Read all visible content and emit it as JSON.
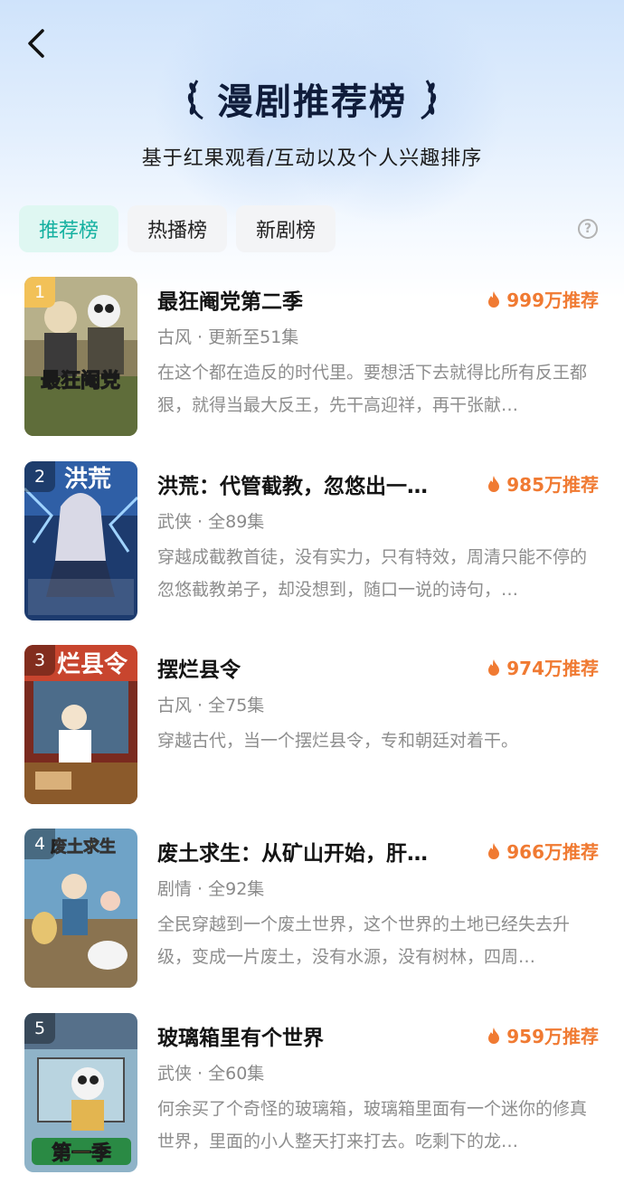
{
  "page": {
    "title": "漫剧推荐榜",
    "subtitle": "基于红果观看/互动以及个人兴趣排序"
  },
  "tabs": [
    {
      "label": "推荐榜",
      "active": true
    },
    {
      "label": "热播榜",
      "active": false
    },
    {
      "label": "新剧榜",
      "active": false
    }
  ],
  "colors": {
    "accent": "#14b0a0",
    "recommend": "#f07a32",
    "gold_rank": "#f2c158"
  },
  "items": [
    {
      "rank": "1",
      "title": "最狂阉党第二季",
      "meta": "古风 · 更新至51集",
      "recommend": "999万推荐",
      "desc": "在这个都在造反的时代里。要想活下去就得比所有反王都狠，就得当最大反王，先干高迎祥，再干张献…",
      "cover_text": "最狂阉党"
    },
    {
      "rank": "2",
      "title": "洪荒：代管截教，忽悠出一…",
      "meta": "武侠 · 全89集",
      "recommend": "985万推荐",
      "desc": "穿越成截教首徒，没有实力，只有特效，周清只能不停的忽悠截教弟子，却没想到，随口一说的诗句，…",
      "cover_text": "洪荒"
    },
    {
      "rank": "3",
      "title": "摆烂县令",
      "meta": "古风 · 全75集",
      "recommend": "974万推荐",
      "desc": "穿越古代，当一个摆烂县令，专和朝廷对着干。",
      "cover_text": "烂县令"
    },
    {
      "rank": "4",
      "title": "废土求生：从矿山开始，肝…",
      "meta": "剧情 · 全92集",
      "recommend": "966万推荐",
      "desc": "全民穿越到一个废土世界，这个世界的土地已经失去升级，变成一片废土，没有水源，没有树林，四周…",
      "cover_text": "废土求生"
    },
    {
      "rank": "5",
      "title": "玻璃箱里有个世界",
      "meta": "武侠 · 全60集",
      "recommend": "959万推荐",
      "desc": "何余买了个奇怪的玻璃箱，玻璃箱里面有一个迷你的修真世界，里面的小人整天打来打去。吃剩下的龙…",
      "cover_text": "第一季"
    }
  ]
}
